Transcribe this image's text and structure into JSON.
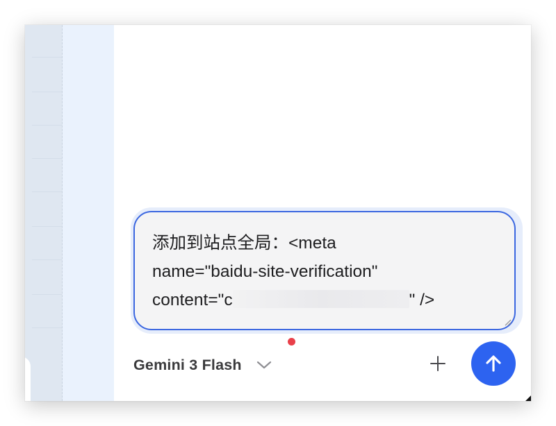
{
  "composer": {
    "line1": "添加到站点全局：<meta",
    "line2": "name=\"baidu-site-verification\"",
    "line3_start": "content=\"c",
    "line3_end": "\" />"
  },
  "toolbar": {
    "model_name": "Gemini 3 Flash",
    "chevron_icon": "chevron-down-icon",
    "add_icon": "plus-icon",
    "send_icon": "arrow-up-icon"
  },
  "colors": {
    "accent": "#2d63f0",
    "input_border": "#3a66e0",
    "status_dot": "#e9404a",
    "sidebar_bg": "#eaf2fd"
  }
}
